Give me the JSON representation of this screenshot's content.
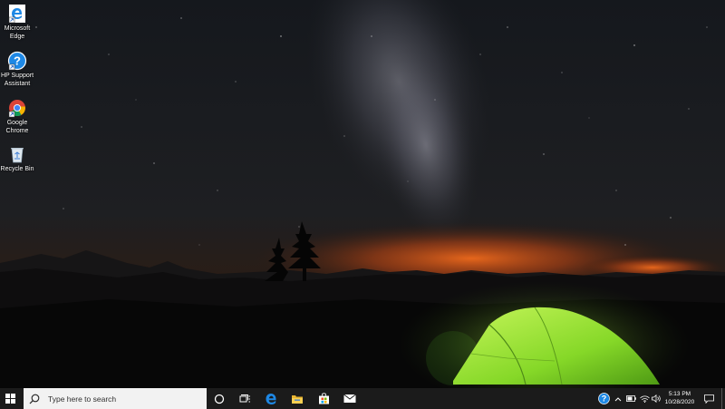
{
  "desktop": {
    "icons": [
      {
        "label": "Microsoft Edge",
        "icon": "edge-icon"
      },
      {
        "label": "HP Support Assistant",
        "icon": "hp-support-icon"
      },
      {
        "label": "Google Chrome",
        "icon": "chrome-icon"
      },
      {
        "label": "Recycle Bin",
        "icon": "recycle-bin-icon"
      }
    ],
    "labels": [
      "Microsoft\nEdge",
      "HP Support\nAssistant",
      "Google\nChrome",
      "Recycle Bin"
    ]
  },
  "taskbar": {
    "search_placeholder": "Type here to search",
    "pinned": [
      "cortana-icon",
      "task-view-icon",
      "edge-icon",
      "file-explorer-icon",
      "store-icon",
      "mail-icon"
    ],
    "tray": [
      "hp-support-icon",
      "chevron-up-icon",
      "battery-icon",
      "wifi-icon",
      "volume-icon"
    ],
    "time": "5:13 PM",
    "date": "10/28/2020"
  },
  "colors": {
    "taskbar_bg": "#1b1b1b",
    "search_bg": "#f2f2f2",
    "tent": "#8fe030",
    "horizon_glow": "#e0581a",
    "accent_blue": "#1e88e5"
  }
}
